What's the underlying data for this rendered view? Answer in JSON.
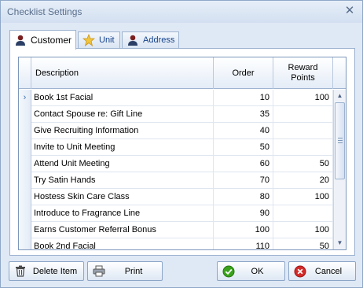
{
  "window": {
    "title": "Checklist Settings",
    "close_glyph": "✕"
  },
  "tabs": [
    {
      "label": "Customer",
      "icon": "person-icon",
      "active": true
    },
    {
      "label": "Unit",
      "icon": "star-icon",
      "active": false
    },
    {
      "label": "Address",
      "icon": "person-icon",
      "active": false
    }
  ],
  "grid": {
    "columns": {
      "description": "Description",
      "order": "Order",
      "reward_points": "Reward Points"
    },
    "current_row_marker": "›",
    "rows": [
      {
        "description": "Book 1st Facial",
        "order": "10",
        "points": "100",
        "current": true
      },
      {
        "description": "Contact Spouse re: Gift Line",
        "order": "35",
        "points": ""
      },
      {
        "description": "Give Recruiting Information",
        "order": "40",
        "points": ""
      },
      {
        "description": "Invite to Unit Meeting",
        "order": "50",
        "points": ""
      },
      {
        "description": "Attend Unit Meeting",
        "order": "60",
        "points": "50"
      },
      {
        "description": "Try Satin Hands",
        "order": "70",
        "points": "20"
      },
      {
        "description": "Hostess Skin Care Class",
        "order": "80",
        "points": "100"
      },
      {
        "description": "Introduce to Fragrance Line",
        "order": "90",
        "points": ""
      },
      {
        "description": "Earns Customer Referral Bonus",
        "order": "100",
        "points": "100"
      },
      {
        "description": "Book 2nd Facial",
        "order": "110",
        "points": "50"
      }
    ],
    "scroll_position": 0.0
  },
  "buttons": {
    "delete": "Delete Item",
    "print": "Print",
    "ok": "OK",
    "cancel": "Cancel"
  },
  "colors": {
    "accent": "#15428b",
    "ok_green": "#3aa21c",
    "cancel_red": "#d42a2a"
  }
}
